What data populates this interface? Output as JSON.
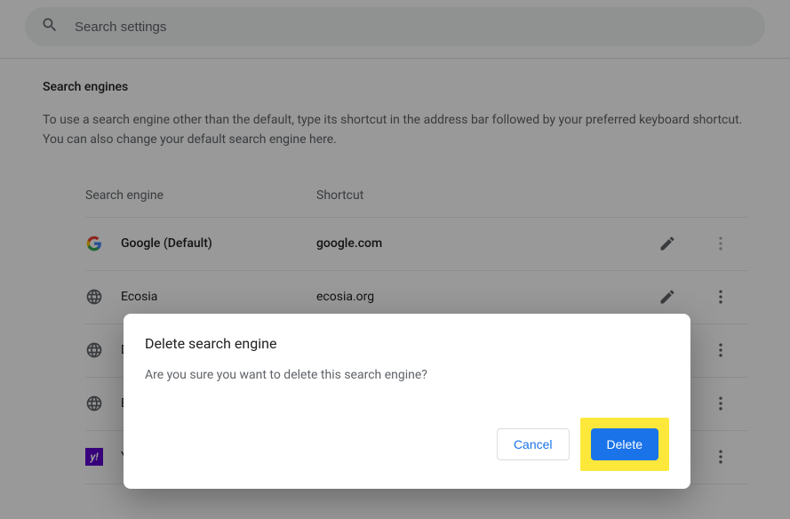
{
  "search": {
    "placeholder": "Search settings"
  },
  "section": {
    "title": "Search engines",
    "description": "To use a search engine other than the default, type its shortcut in the address bar followed by your preferred keyboard shortcut. You can also change your default search engine here."
  },
  "table": {
    "col_engine": "Search engine",
    "col_shortcut": "Shortcut",
    "rows": [
      {
        "name": "Google (Default)",
        "shortcut": "google.com",
        "icon": "google",
        "bold": true,
        "editable": true
      },
      {
        "name": "Ecosia",
        "shortcut": "ecosia.org",
        "icon": "globe",
        "bold": false,
        "editable": true
      },
      {
        "name": "D",
        "shortcut": "",
        "icon": "globe",
        "bold": false,
        "editable": false
      },
      {
        "name": "B",
        "shortcut": "",
        "icon": "globe",
        "bold": false,
        "editable": false
      },
      {
        "name": "Y",
        "shortcut": "",
        "icon": "yahoo",
        "bold": false,
        "editable": false
      }
    ]
  },
  "dialog": {
    "title": "Delete search engine",
    "message": "Are you sure you want to delete this search engine?",
    "cancel": "Cancel",
    "delete": "Delete"
  }
}
